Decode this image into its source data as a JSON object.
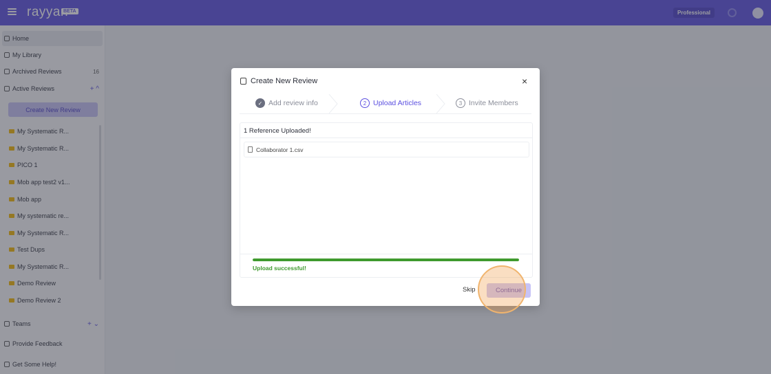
{
  "app": {
    "brand": "rayyan",
    "badge": "BETA",
    "plan": "Professional"
  },
  "sidebar": {
    "items": [
      {
        "label": "Home"
      },
      {
        "label": "My Library"
      },
      {
        "label": "Archived Reviews",
        "count": "16"
      },
      {
        "label": "Active Reviews",
        "actions": "+ ^"
      }
    ],
    "create_label": "Create New Review",
    "reviews": [
      "My Systematic R...",
      "My Systematic R...",
      "PICO 1",
      "Mob app test2 v1...",
      "Mob app",
      "My systematic re...",
      "My Systematic R...",
      "Test Dups",
      "My Systematic R...",
      "Demo Review",
      "Demo Review 2"
    ],
    "bottom": [
      {
        "label": "Teams",
        "actions": "+ ⌄"
      },
      {
        "label": "Provide Feedback"
      },
      {
        "label": "Get Some Help!"
      }
    ]
  },
  "modal": {
    "title": "Create New Review",
    "close_glyph": "×",
    "steps": [
      {
        "num": "✓",
        "label": "Add review info",
        "state": "done",
        "color": "#8a8d99"
      },
      {
        "num": "2",
        "label": "Upload Articles",
        "state": "active",
        "color": "#5b4fe0"
      },
      {
        "num": "3",
        "label": "Invite Members",
        "state": "pending",
        "color": "#8a8d99"
      }
    ],
    "uploaded_label": "1 Reference Uploaded!",
    "file_name": "Collaborator 1.csv",
    "progress": 1.0,
    "status": "Upload successful!",
    "skip_label": "Skip",
    "continue_label": "Continue"
  },
  "colors": {
    "brand": "#5b4fe0",
    "success": "#3f9a2e"
  }
}
